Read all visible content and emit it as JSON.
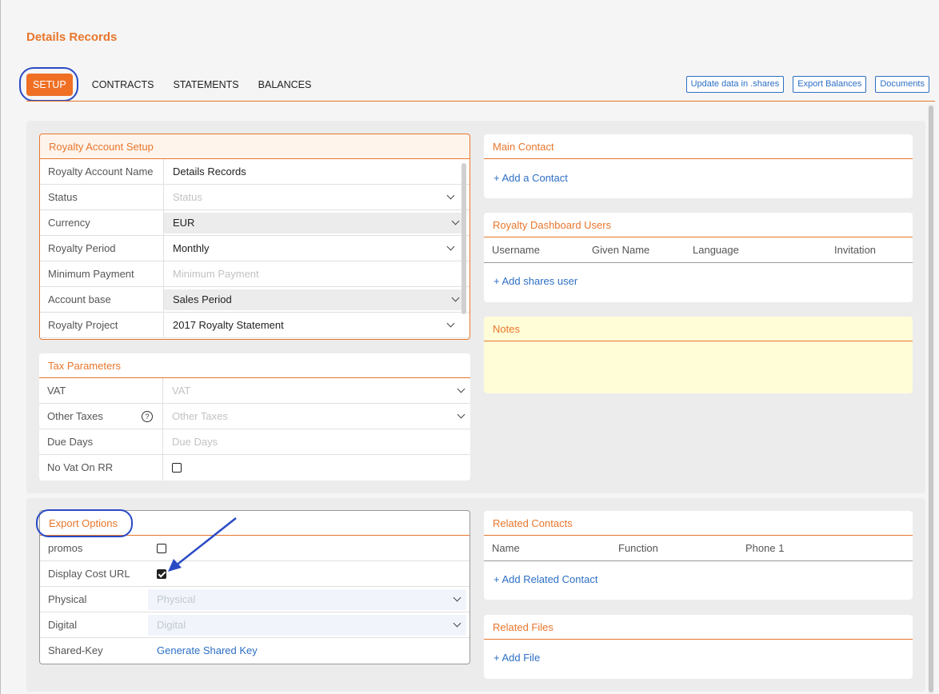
{
  "page_title": "Details Records",
  "tabs": [
    {
      "label": "SETUP",
      "active": true
    },
    {
      "label": "CONTRACTS",
      "active": false
    },
    {
      "label": "STATEMENTS",
      "active": false
    },
    {
      "label": "BALANCES",
      "active": false
    }
  ],
  "top_actions": [
    "Update data in .shares",
    "Export Balances",
    "Documents"
  ],
  "royalty_account_setup": {
    "title": "Royalty Account Setup",
    "rows": [
      {
        "label": "Royalty Account Name",
        "value": "Details Records",
        "placeholder": false,
        "dropdown": false
      },
      {
        "label": "Status",
        "value": "Status",
        "placeholder": true,
        "dropdown": true
      },
      {
        "label": "Currency",
        "value": "EUR",
        "placeholder": false,
        "dropdown": true,
        "shaded": true
      },
      {
        "label": "Royalty Period",
        "value": "Monthly",
        "placeholder": false,
        "dropdown": true
      },
      {
        "label": "Minimum Payment",
        "value": "Minimum Payment",
        "placeholder": true,
        "dropdown": false
      },
      {
        "label": "Account base",
        "value": "Sales Period",
        "placeholder": false,
        "dropdown": true,
        "shaded": true
      },
      {
        "label": "Royalty Project",
        "value": "2017 Royalty Statement",
        "placeholder": false,
        "dropdown": true
      }
    ]
  },
  "tax_parameters": {
    "title": "Tax Parameters",
    "rows": [
      {
        "label": "VAT",
        "value": "VAT"
      },
      {
        "label": "Other Taxes",
        "value": "Other Taxes",
        "help_icon": "?"
      },
      {
        "label": "Due Days",
        "value": "Due Days"
      },
      {
        "label": "No Vat On RR",
        "checked": false
      }
    ]
  },
  "main_contact": {
    "title": "Main Contact",
    "add_link": "+ Add a Contact"
  },
  "dashboard_users": {
    "title": "Royalty Dashboard Users",
    "columns": [
      "Username",
      "Given Name",
      "Language",
      "Invitation"
    ],
    "add_link": "+ Add shares user"
  },
  "notes": {
    "title": "Notes"
  },
  "export_options": {
    "title": "Export Options",
    "rows": [
      {
        "label": "promos",
        "checked": false
      },
      {
        "label": "Display Cost URL",
        "checked": true
      },
      {
        "label": "Physical",
        "value": "Physical"
      },
      {
        "label": "Digital",
        "value": "Digital"
      },
      {
        "label": "Shared-Key",
        "link": "Generate Shared Key"
      }
    ]
  },
  "related_contacts": {
    "title": "Related Contacts",
    "columns": [
      "Name",
      "Function",
      "Phone 1"
    ],
    "add_link": "+ Add Related Contact"
  },
  "related_files": {
    "title": "Related Files",
    "add_link": "+ Add File"
  },
  "colors": {
    "accent": "#e8762c",
    "tab_active": "#ef6f25",
    "link": "#2d6fc4",
    "annotation": "#2a4ac4",
    "notes_bg": "#fffdd8"
  }
}
